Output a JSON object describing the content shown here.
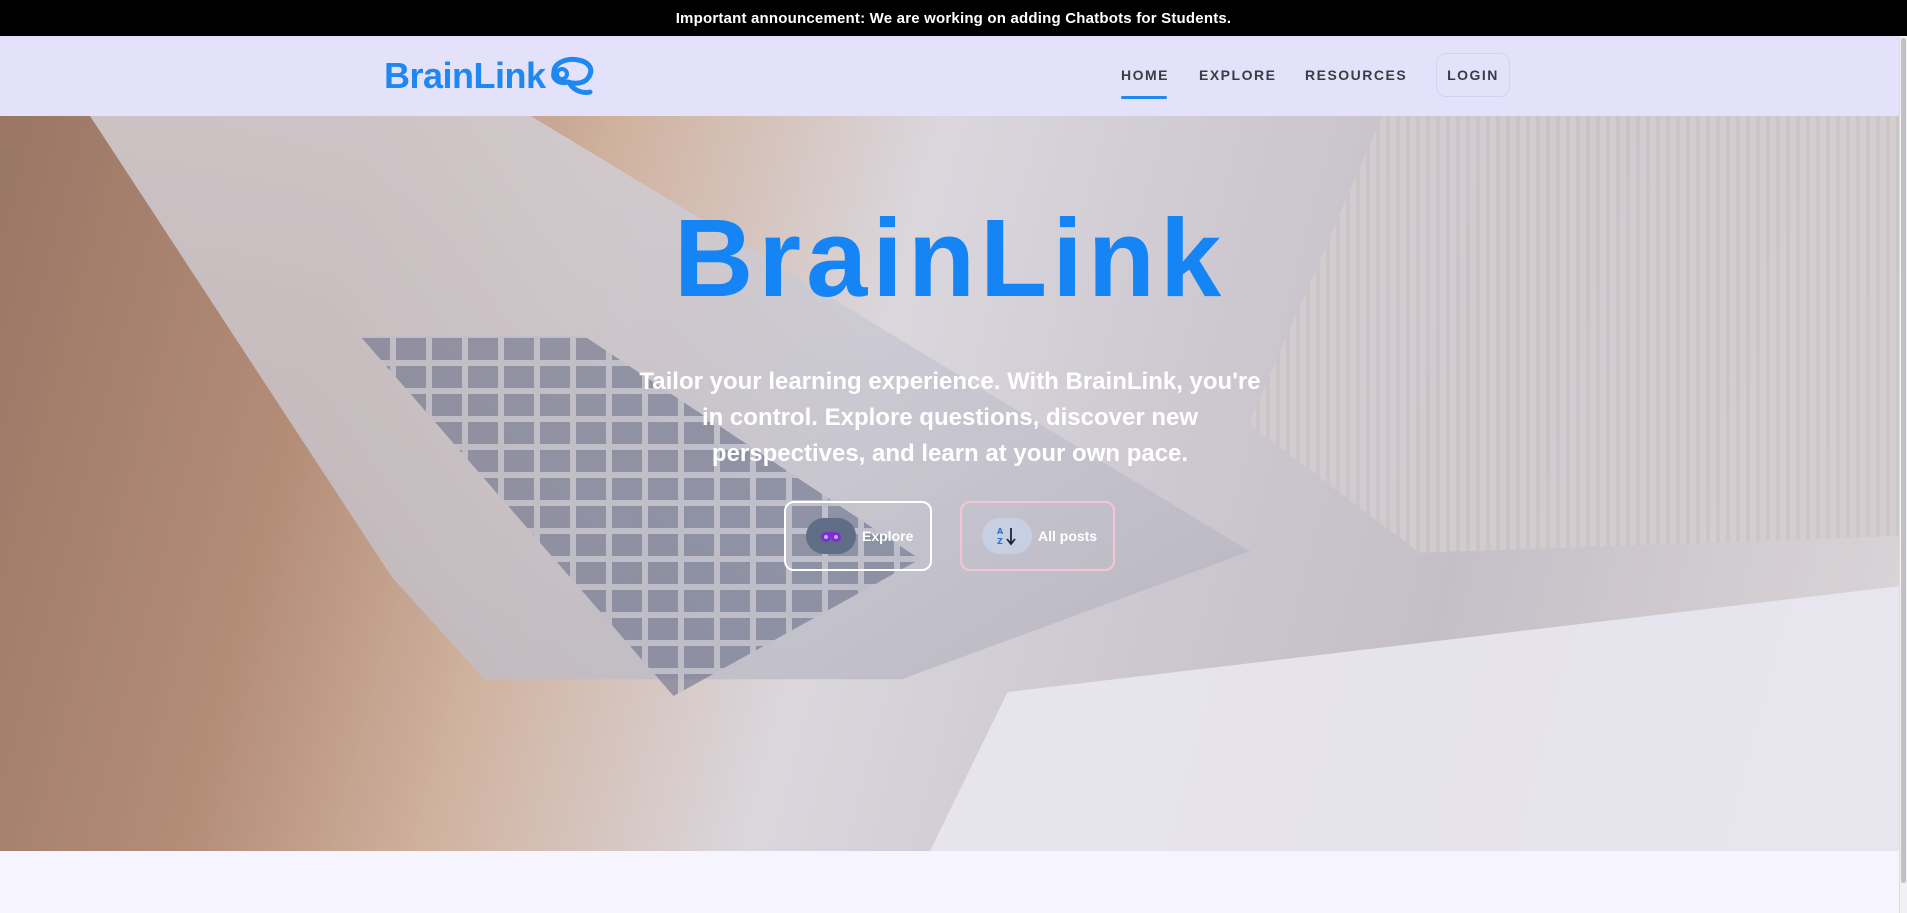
{
  "announcement": {
    "text": "Important announcement: We are working on adding Chatbots for Students."
  },
  "brand": {
    "logo_text": "BrainLink",
    "accent_color": "#1e88f0"
  },
  "nav": {
    "items": [
      {
        "label": "HOME",
        "active": true
      },
      {
        "label": "EXPLORE",
        "active": false
      },
      {
        "label": "RESOURCES",
        "active": false
      }
    ],
    "login_label": "LOGIN"
  },
  "hero": {
    "title": "BrainLink",
    "subtitle": "Tailor your learning experience. With BrainLink, you're in control. Explore questions, discover new perspectives, and learn at your own pace.",
    "buttons": [
      {
        "label": "Explore",
        "icon": "binoculars-icon"
      },
      {
        "label": "All posts",
        "icon": "sort-az-icon"
      }
    ]
  }
}
